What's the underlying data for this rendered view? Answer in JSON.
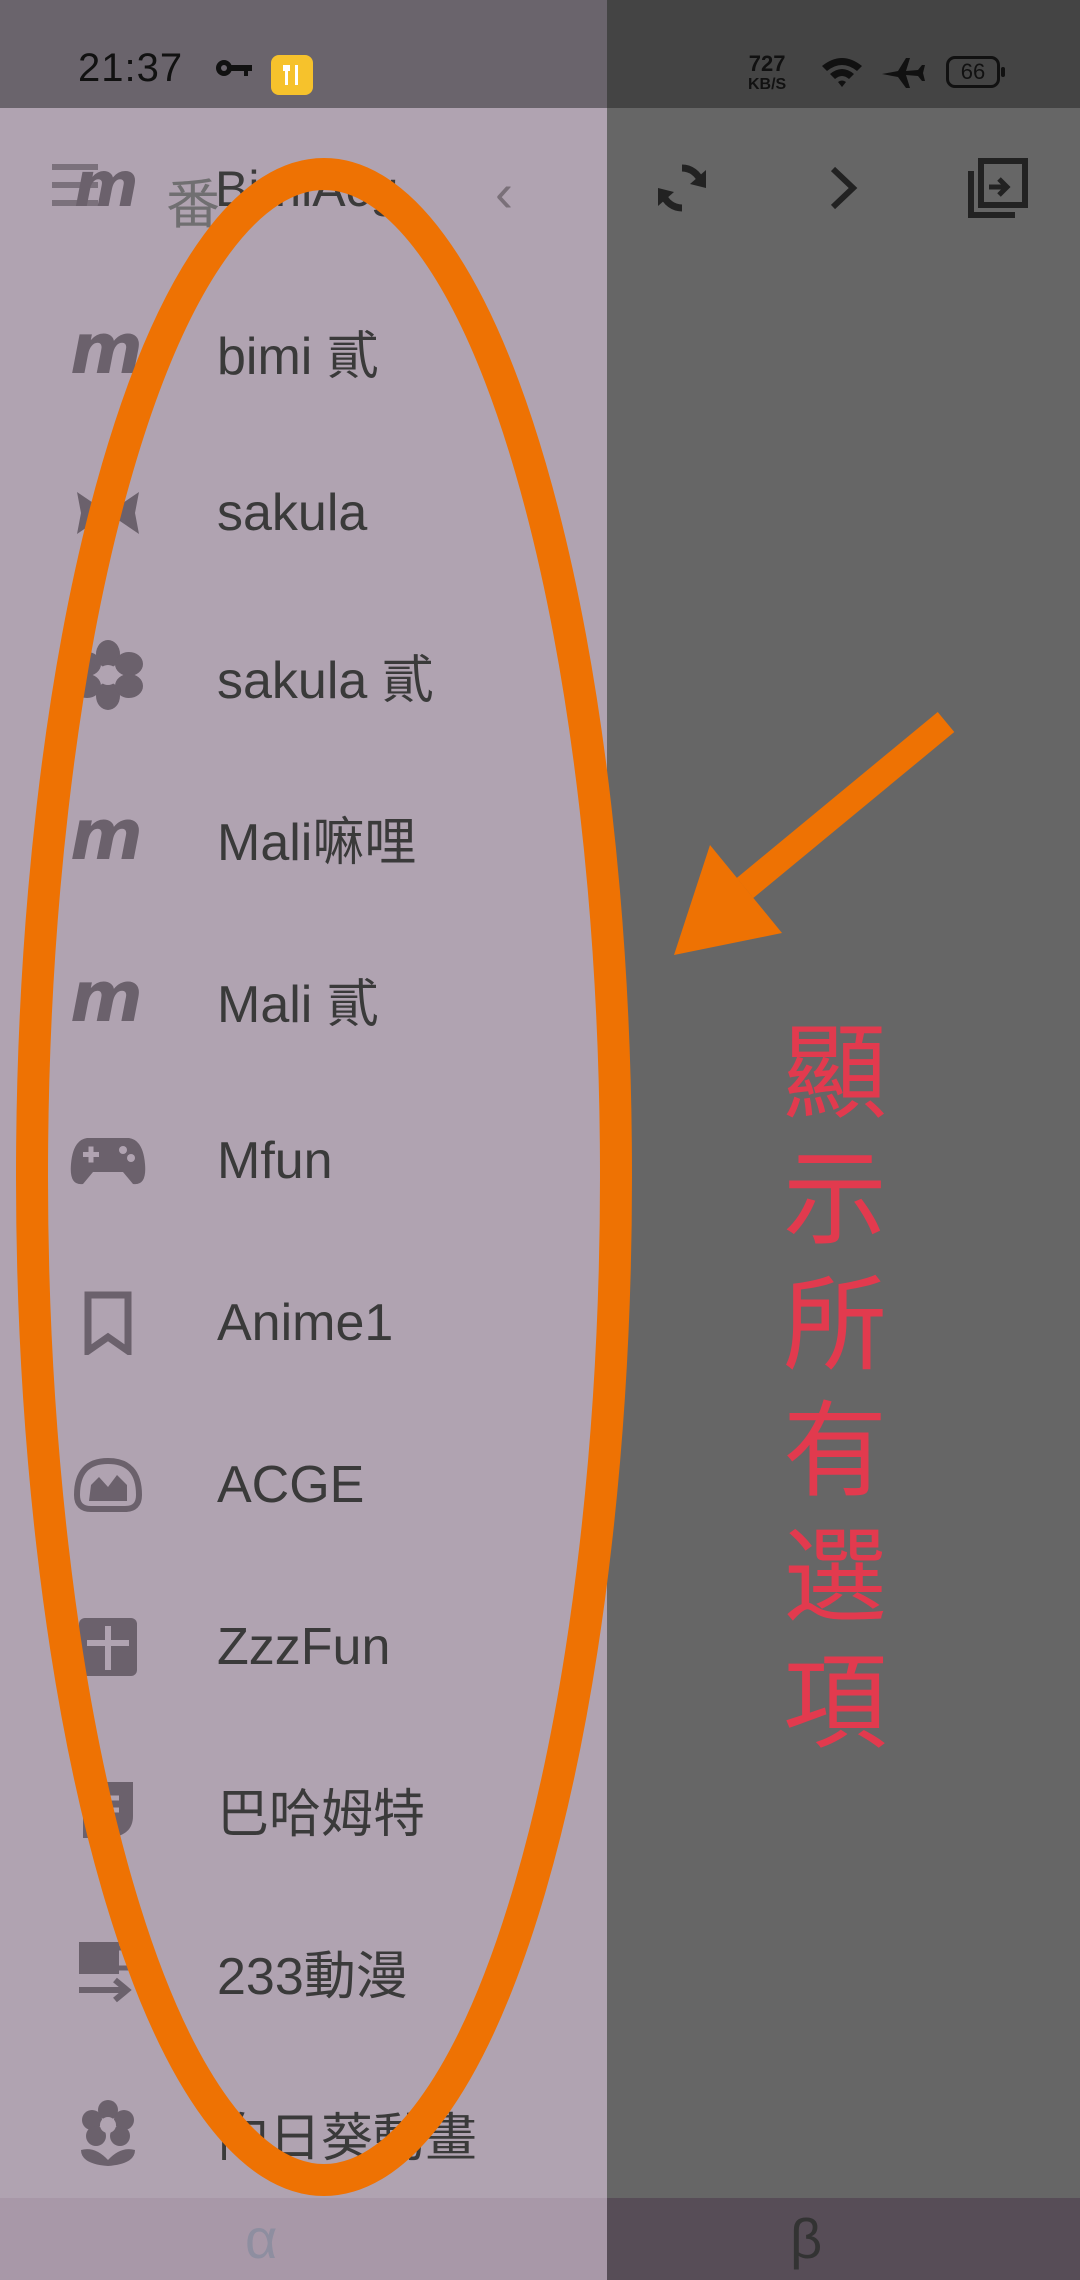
{
  "status_bar": {
    "time": "21:37",
    "speed_value": "727",
    "speed_unit": "KB/S",
    "battery": "66",
    "icons": [
      "key-icon",
      "app-notification-icon",
      "wifi-icon",
      "airplane-mode-icon",
      "battery-icon"
    ]
  },
  "drawer": {
    "header_prefix": "番",
    "header_title": "BimiAcg",
    "items": [
      {
        "label": "bimi 貳",
        "icon": "m-logo-icon"
      },
      {
        "label": "sakula",
        "icon": "bow-icon"
      },
      {
        "label": "sakula 貳",
        "icon": "flower-gear-icon"
      },
      {
        "label": "Mali嘛哩",
        "icon": "m-logo-icon"
      },
      {
        "label": "Mali 貳",
        "icon": "m-logo-icon"
      },
      {
        "label": "Mfun",
        "icon": "gamepad-icon"
      },
      {
        "label": "Anime1",
        "icon": "bookmark-icon"
      },
      {
        "label": "ACGE",
        "icon": "basket-icon"
      },
      {
        "label": "ZzzFun",
        "icon": "plus-box-icon"
      },
      {
        "label": "巴哈姆特",
        "icon": "shield-icon"
      },
      {
        "label": "233動漫",
        "icon": "cup-arrow-icon"
      },
      {
        "label": "向日葵動畫",
        "icon": "sunflower-icon"
      }
    ]
  },
  "toolbar": {
    "icons": [
      "back-chevron-icon",
      "refresh-icon",
      "forward-chevron-icon",
      "exit-icon"
    ]
  },
  "bottom_tabs": {
    "alpha": "α",
    "beta": "β"
  },
  "annotation": {
    "text_chars": [
      "顯",
      "示",
      "所",
      "有",
      "選",
      "項"
    ],
    "color": "#e23a4e",
    "shape_color": "#ee7203"
  }
}
